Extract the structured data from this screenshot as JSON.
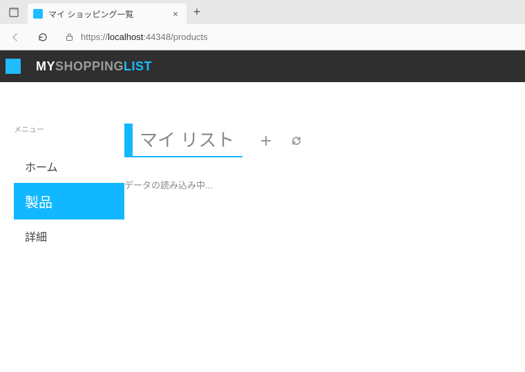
{
  "browser": {
    "tab_title": "マイ ショッピング一覧",
    "url_prefix": "https://",
    "url_host": "localhost",
    "url_port_path": ":44348/products"
  },
  "brand": {
    "w1": "MY",
    "w2": "SHOPPING",
    "w3": "LIST"
  },
  "sidebar": {
    "menu_label": "メニュー",
    "items": [
      {
        "label": "ホーム"
      },
      {
        "label": "製品"
      },
      {
        "label": "詳細"
      }
    ],
    "active_index": 1
  },
  "main": {
    "title": "マイ リスト",
    "loading": "データの読み込み中..."
  }
}
